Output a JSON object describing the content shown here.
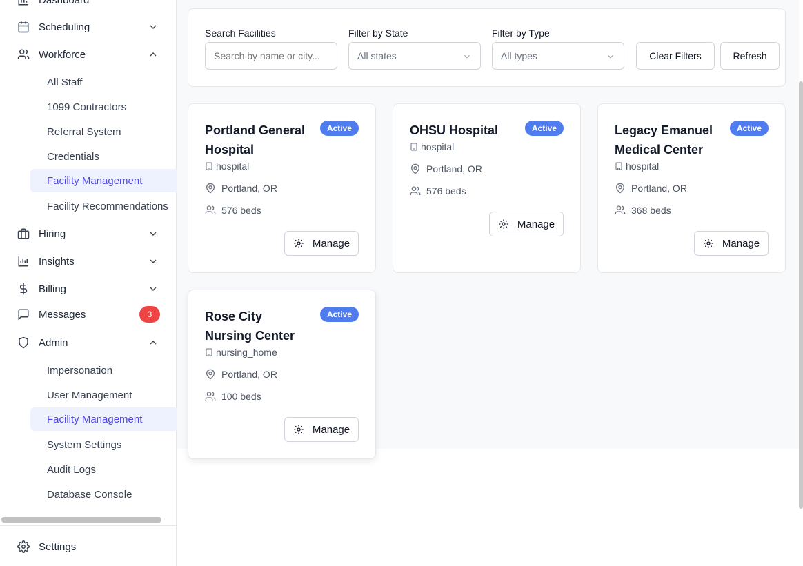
{
  "sidebar": {
    "dashboard": "Dashboard",
    "scheduling": "Scheduling",
    "workforce": "Workforce",
    "workforce_items": [
      "All Staff",
      "1099 Contractors",
      "Referral System",
      "Credentials",
      "Facility Management",
      "Facility Recommendations"
    ],
    "hiring": "Hiring",
    "insights": "Insights",
    "billing": "Billing",
    "messages": "Messages",
    "messages_count": "3",
    "admin": "Admin",
    "admin_items": [
      "Impersonation",
      "User Management",
      "Facility Management",
      "System Settings",
      "Audit Logs",
      "Database Console"
    ],
    "settings": "Settings",
    "active_color": "#4f46e5"
  },
  "filters": {
    "search_label": "Search Facilities",
    "search_placeholder": "Search by name or city...",
    "state_label": "Filter by State",
    "state_value": "All states",
    "type_label": "Filter by Type",
    "type_value": "All types",
    "clear_label": "Clear Filters",
    "refresh_label": "Refresh"
  },
  "facilities": [
    {
      "name": "Portland General Hospital",
      "status": "Active",
      "type": "hospital",
      "location": "Portland, OR",
      "beds": "576 beds",
      "manage": "Manage"
    },
    {
      "name": "OHSU Hospital",
      "status": "Active",
      "type": "hospital",
      "location": "Portland, OR",
      "beds": "576 beds",
      "manage": "Manage"
    },
    {
      "name": "Legacy Emanuel Medical Center",
      "status": "Active",
      "type": "hospital",
      "location": "Portland, OR",
      "beds": "368 beds",
      "manage": "Manage"
    },
    {
      "name": "Rose City Nursing Center",
      "status": "Active",
      "type": "nursing_home",
      "location": "Portland, OR",
      "beds": "100 beds",
      "manage": "Manage"
    }
  ],
  "colors": {
    "status_badge": "#4f7df0",
    "badge_count": "#ef4444"
  },
  "icons": {
    "dashboard": "bar-chart-icon",
    "scheduling": "calendar-icon",
    "workforce": "users-icon",
    "hiring": "briefcase-icon",
    "insights": "chart-icon",
    "billing": "dollar-icon",
    "messages": "message-icon",
    "admin": "shield-icon",
    "settings": "gear-icon"
  }
}
